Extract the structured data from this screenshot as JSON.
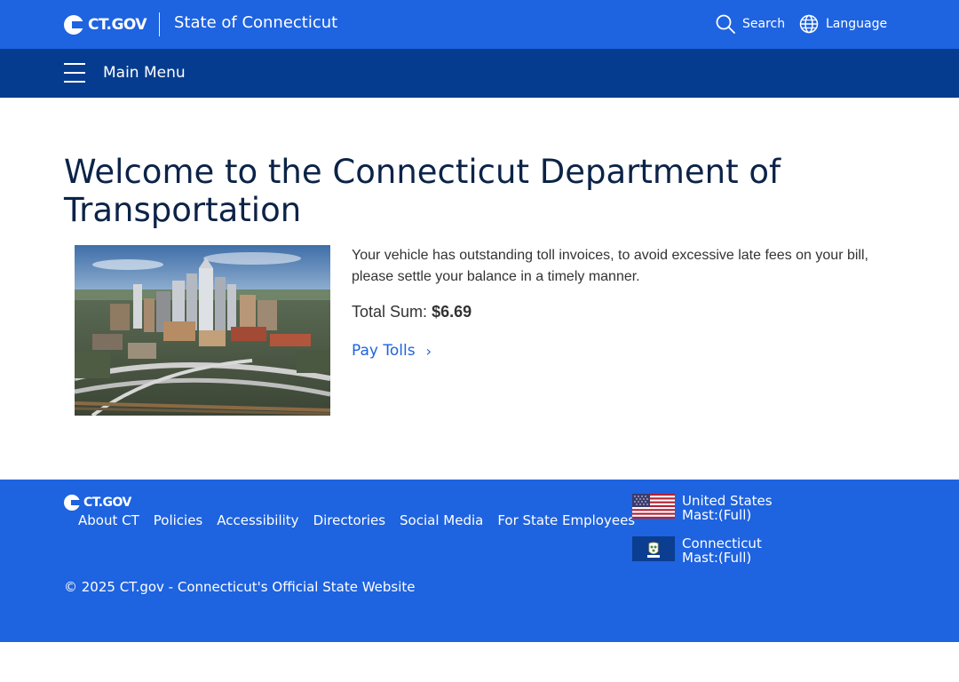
{
  "header": {
    "logo_text": "CT.GOV",
    "state_name": "State of Connecticut",
    "search_label": "Search",
    "language_label": "Language"
  },
  "menu": {
    "label": "Main Menu"
  },
  "main": {
    "title": "Welcome to the Connecticut Department of Transportation",
    "notice": "Your vehicle has outstanding toll invoices, to avoid excessive late fees on your bill, please settle your balance in a timely manner.",
    "total_label": "Total Sum:",
    "total_amount": "$6.69",
    "pay_link": "Pay Tolls"
  },
  "footer": {
    "logo_text": "CT.GOV",
    "links": [
      "About CT",
      "Policies",
      "Accessibility",
      "Directories",
      "Social Media",
      "For State Employees"
    ],
    "mast_us_line1": "United States",
    "mast_us_line2": "Mast:(Full)",
    "mast_ct_line1": "Connecticut",
    "mast_ct_line2": "Mast:(Full)",
    "copyright": "© 2025 CT.gov - Connecticut's Official State Website"
  },
  "colors": {
    "brand_blue": "#1e63e0",
    "nav_dark_blue": "#063c8f",
    "title_navy": "#0c2348"
  },
  "icons": {
    "search": "search-icon",
    "language": "globe-icon",
    "menu": "hamburger-icon",
    "chevron": "chevron-right-icon"
  }
}
